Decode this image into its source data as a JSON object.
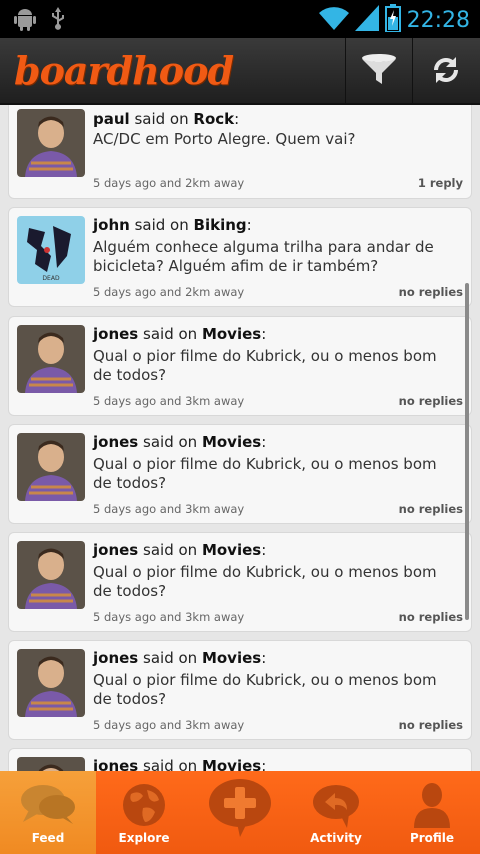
{
  "status_bar": {
    "time": "22:28"
  },
  "app": {
    "logo_text": "boardhood"
  },
  "toolbar": {
    "filter_icon": "funnel-icon",
    "refresh_icon": "refresh-icon"
  },
  "posts": [
    {
      "user": "paul",
      "said_on": "said on",
      "board": "Rock",
      "message": "AC/DC em Porto Alegre. Quem vai?",
      "meta": "5 days ago and 2km away",
      "replies": "1 reply",
      "avatar": "person"
    },
    {
      "user": "john",
      "said_on": "said on",
      "board": "Biking",
      "message": "Alguém conhece alguma trilha para andar de bicicleta? Alguém afim de ir também?",
      "meta": "5 days ago and 2km away",
      "replies": "no replies",
      "avatar": "album"
    },
    {
      "user": "jones",
      "said_on": "said on",
      "board": "Movies",
      "message": "Qual o pior filme do Kubrick, ou o menos bom de todos?",
      "meta": "5 days ago and 3km away",
      "replies": "no replies",
      "avatar": "person"
    },
    {
      "user": "jones",
      "said_on": "said on",
      "board": "Movies",
      "message": "Qual o pior filme do Kubrick, ou o menos bom de todos?",
      "meta": "5 days ago and 3km away",
      "replies": "no replies",
      "avatar": "person"
    },
    {
      "user": "jones",
      "said_on": "said on",
      "board": "Movies",
      "message": "Qual o pior filme do Kubrick, ou o menos bom de todos?",
      "meta": "5 days ago and 3km away",
      "replies": "no replies",
      "avatar": "person"
    },
    {
      "user": "jones",
      "said_on": "said on",
      "board": "Movies",
      "message": "Qual o pior filme do Kubrick, ou o menos bom de todos?",
      "meta": "5 days ago and 3km away",
      "replies": "no replies",
      "avatar": "person"
    },
    {
      "user": "jones",
      "said_on": "said on",
      "board": "Movies"
    }
  ],
  "tabs": [
    {
      "label": "Feed",
      "icon": "speech-bubbles-icon",
      "active": true
    },
    {
      "label": "Explore",
      "icon": "globe-icon",
      "active": false
    },
    {
      "label": "",
      "icon": "plus-bubble-icon",
      "active": false
    },
    {
      "label": "Activity",
      "icon": "reply-bubble-icon",
      "active": false
    },
    {
      "label": "Profile",
      "icon": "user-icon",
      "active": false
    }
  ],
  "colors": {
    "accent": "#f05a14",
    "tab_bar": "#ff6a1a",
    "status_accent": "#33b5e5"
  }
}
